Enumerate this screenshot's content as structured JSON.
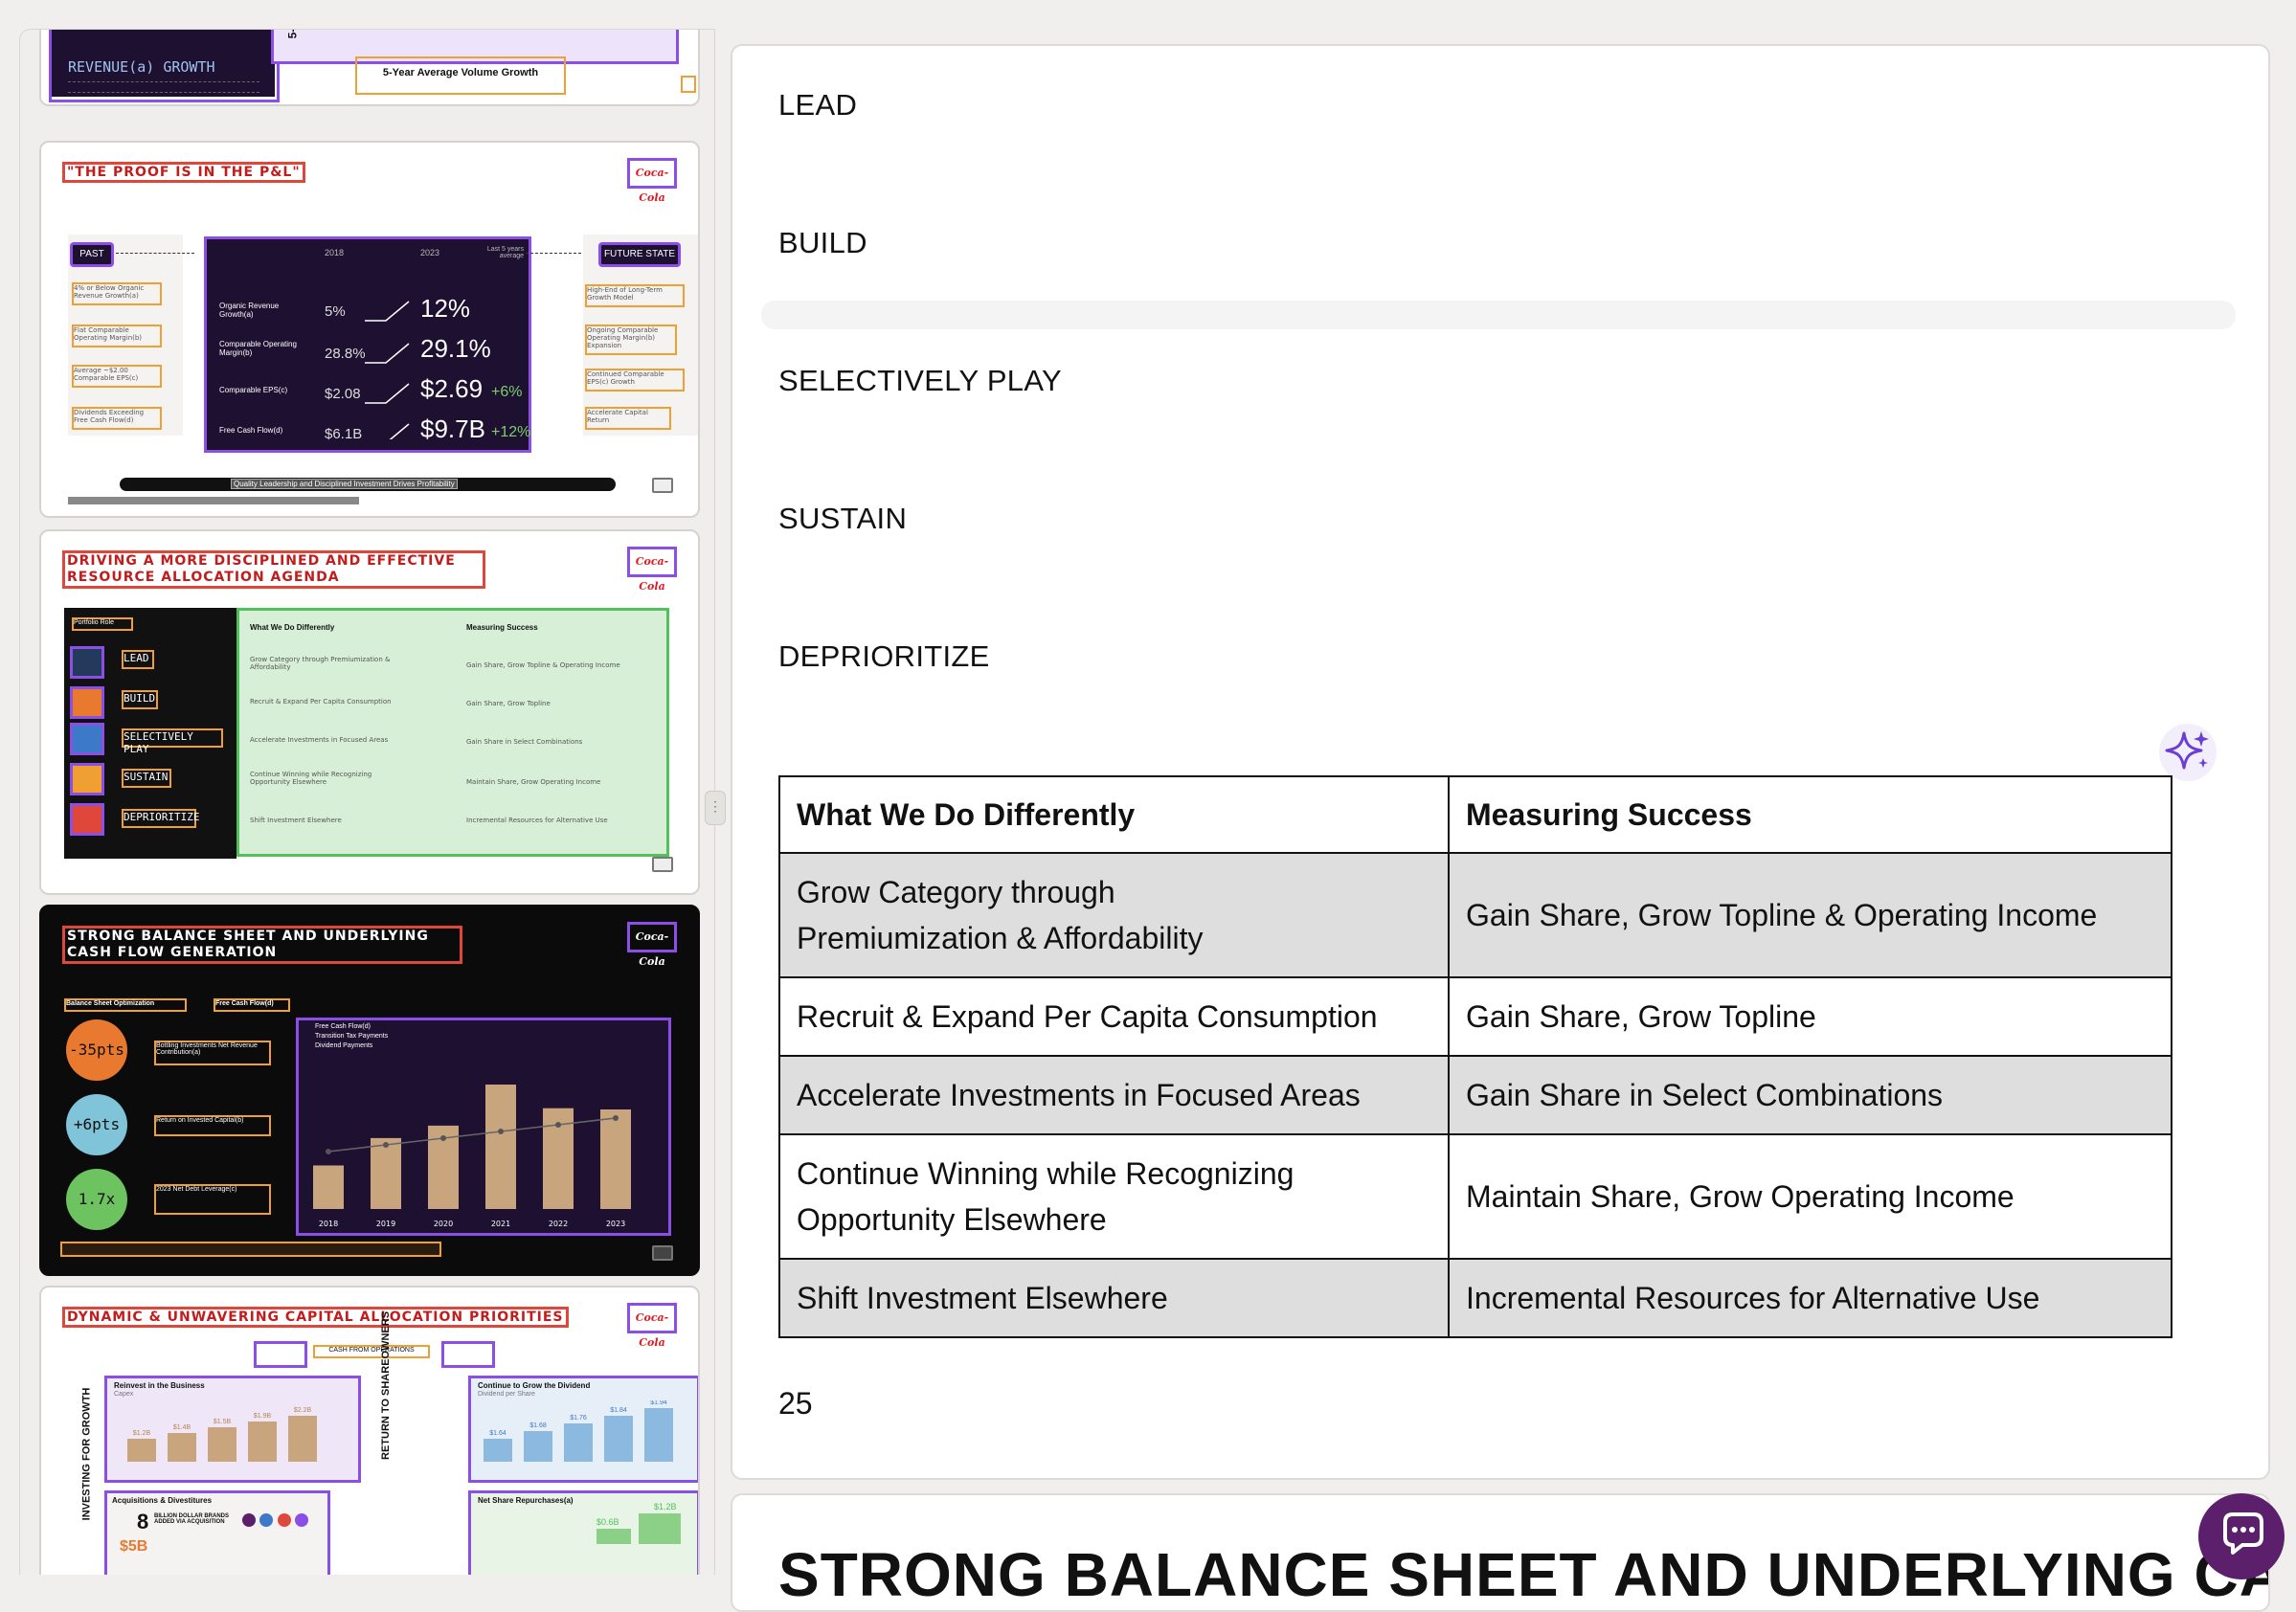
{
  "colors": {
    "accent_purple": "#8b4fe8",
    "label_red": "#e0473b",
    "label_orange": "#f0a032",
    "label_green": "#52c15a",
    "chat_button": "#5b1f6b",
    "table_shade": "#dedede"
  },
  "thumbnails": {
    "slide1": {
      "title": "REVENUE(a) GROWTH",
      "side_label": "5-Ye",
      "bottom_label": "5-Year Average Volume Growth"
    },
    "slide2": {
      "title": "\"THE PROOF IS IN THE P&L\"",
      "logo": "Coca-Cola",
      "past_label": "PAST",
      "future_label": "FUTURE STATE",
      "col_2018": "2018",
      "col_2023": "2023",
      "col_last5": "Last 5 years average",
      "past_items": [
        "4% or Below Organic Revenue Growth(a)",
        "Flat Comparable Operating Margin(b)",
        "Average ~$2.00 Comparable EPS(c)",
        "Dividends Exceeding Free Cash Flow(d)"
      ],
      "future_items": [
        "High-End of Long-Term Growth Model",
        "Ongoing Comparable Operating Margin(b) Expansion",
        "Continued Comparable EPS(c) Growth",
        "Accelerate Capital Return"
      ],
      "rows": [
        {
          "label": "Organic Revenue Growth(a)",
          "v2018": "5%",
          "v2023": "12%",
          "avg": ""
        },
        {
          "label": "Comparable Operating Margin(b)",
          "v2018": "28.8%",
          "v2023": "29.1%",
          "avg": ""
        },
        {
          "label": "Comparable EPS(c)",
          "v2018": "$2.08",
          "v2023": "$2.69",
          "avg": "+6%"
        },
        {
          "label": "Free Cash Flow(d)",
          "v2018": "$6.1B",
          "v2023": "$9.7B",
          "avg": "+12%"
        }
      ],
      "footer": "Quality Leadership and Disciplined Investment Drives Profitability"
    },
    "slide3": {
      "title_line1": "DRIVING A MORE DISCIPLINED AND EFFECTIVE",
      "title_line2": "RESOURCE ALLOCATION AGENDA",
      "logo": "Coca-Cola",
      "portfolio_role": "Portfolio Role",
      "col1": "What We Do Differently",
      "col2": "Measuring Success",
      "roles": [
        "LEAD",
        "BUILD",
        "SELECTIVELY PLAY",
        "SUSTAIN",
        "DEPRIORITIZE"
      ],
      "left_items": [
        "Grow Category through Premiumization & Affordability",
        "Recruit & Expand Per Capita Consumption",
        "Accelerate Investments in Focused Areas",
        "Continue Winning while Recognizing Opportunity Elsewhere",
        "Shift Investment Elsewhere"
      ],
      "right_items": [
        "Gain Share, Grow Topline & Operating Income",
        "Gain Share, Grow Topline",
        "Gain Share in Select Combinations",
        "Maintain Share, Grow Operating Income",
        "Incremental Resources for Alternative Use"
      ]
    },
    "slide4": {
      "title_line1": "STRONG BALANCE SHEET AND UNDERLYING",
      "title_line2": "CASH FLOW GENERATION",
      "logo": "Coca-Cola",
      "section_left": "Balance Sheet Optimization",
      "section_right": "Free Cash Flow(d)",
      "circles": [
        {
          "value": "-35pts",
          "color": "#e9792f",
          "text": "Bottling Investments Net Revenue Contribution(a)"
        },
        {
          "value": "+6pts",
          "color": "#7fc4d9",
          "text": "Return on Invested Capital(b)"
        },
        {
          "value": "1.7x",
          "color": "#6cc35f",
          "text": "2023 Net Debt Leverage(c)"
        }
      ],
      "legend": [
        "Free Cash Flow(d)",
        "Transition Tax Payments",
        "Dividend Payments"
      ],
      "years": [
        "2018",
        "2019",
        "2020",
        "2021",
        "2022",
        "2023"
      ],
      "bar_heights": [
        0.35,
        0.57,
        0.67,
        1.0,
        0.81,
        0.8
      ]
    },
    "slide5": {
      "title": "DYNAMIC & UNWAVERING CAPITAL ALLOCATION PRIORITIES",
      "logo": "Coca-Cola",
      "cash_label": "CASH FROM OPERATIONS",
      "left_vertical": "INVESTING FOR GROWTH",
      "right_vertical": "RETURN TO SHAREOWNERS",
      "box1_title": "Reinvest in the Business",
      "box1_sub": "Capex",
      "box1_values": [
        "$1.2B",
        "$1.4B",
        "$1.5B",
        "$1.9B",
        "$2.2B"
      ],
      "box2_title": "Continue to Grow the Dividend",
      "box2_sub": "Dividend per Share",
      "box2_values": [
        "$1.64",
        "$1.68",
        "$1.76",
        "$1.84",
        "$1.94"
      ],
      "box3_title": "Acquisitions & Divestitures",
      "box3_value": "8",
      "box3_text": "BILLION DOLLAR BRANDS ADDED VIA ACQUISITION",
      "box4_title": "Net Share Repurchases(a)",
      "box4_values": [
        "$0.6B",
        "$1.2B"
      ],
      "box3_bottom": "$5B"
    }
  },
  "main": {
    "roles": [
      "LEAD",
      "BUILD",
      "SELECTIVELY PLAY",
      "SUSTAIN",
      "DEPRIORITIZE"
    ],
    "table": {
      "headers": [
        "What We Do Differently",
        "Measuring Success"
      ],
      "rows": [
        {
          "left_line1": "Grow Category through",
          "left_line2": "Premiumization & Affordability",
          "right": "Gain Share, Grow Topline & Operating Income"
        },
        {
          "left_line1": "Recruit & Expand Per Capita Consumption",
          "left_line2": "",
          "right": "Gain Share, Grow Topline"
        },
        {
          "left_line1": "Accelerate Investments in Focused Areas",
          "left_line2": "",
          "right": "Gain Share in Select Combinations"
        },
        {
          "left_line1": "Continue Winning while Recognizing",
          "left_line2": "Opportunity Elsewhere",
          "right": "Maintain Share, Grow Operating Income"
        },
        {
          "left_line1": "Shift Investment Elsewhere",
          "left_line2": "",
          "right": "Incremental Resources for Alternative Use"
        }
      ]
    },
    "page_number": "25",
    "next_section_title": "STRONG BALANCE SHEET AND UNDERLYING CASH"
  },
  "icons": {
    "sparkle": "sparkle-icon",
    "chat": "chat-icon",
    "divider": "drag-handle-icon",
    "slide": "slide-icon"
  }
}
